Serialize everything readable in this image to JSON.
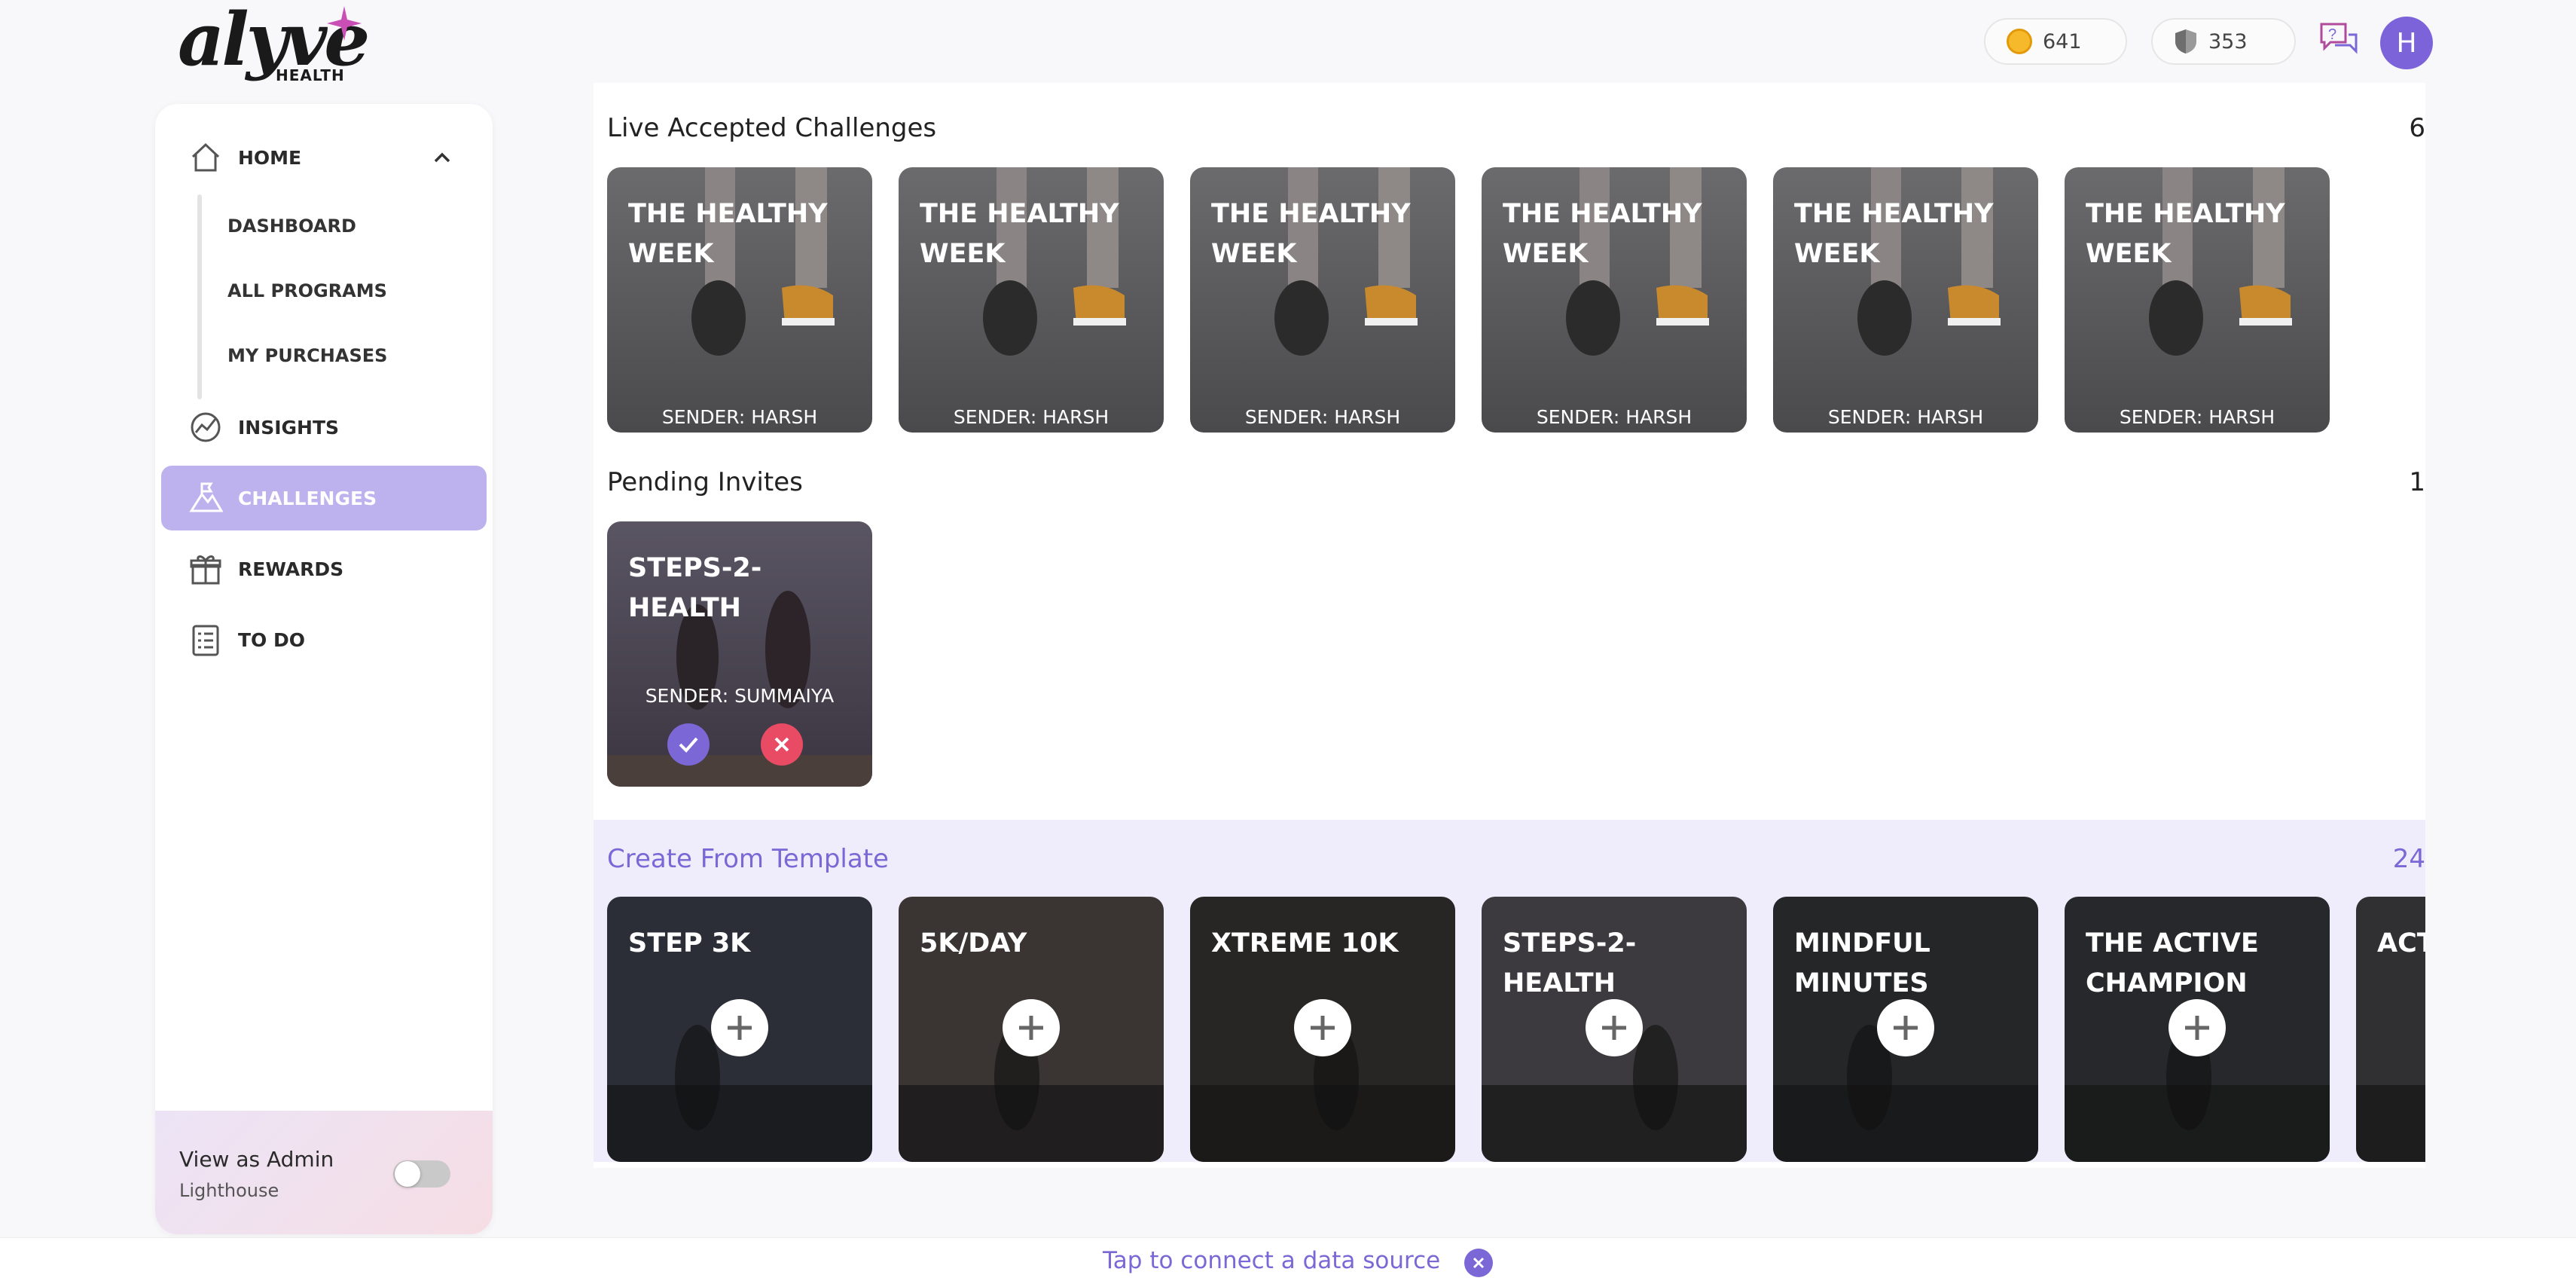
{
  "brand": {
    "name": "alyve",
    "sub": "HEALTH"
  },
  "header": {
    "coins": "641",
    "shields": "353",
    "avatar_initial": "H"
  },
  "sidebar": {
    "home": "HOME",
    "sub_items": [
      "DASHBOARD",
      "ALL PROGRAMS",
      "MY PURCHASES"
    ],
    "insights": "INSIGHTS",
    "challenges": "CHALLENGES",
    "rewards": "REWARDS",
    "todo": "TO DO",
    "admin_title": "View as Admin",
    "admin_sub": "Lighthouse"
  },
  "live": {
    "title": "Live Accepted Challenges",
    "count": "6",
    "cards": [
      {
        "title": "THE HEALTHY WEEK",
        "sender": "SENDER: HARSH"
      },
      {
        "title": "THE HEALTHY WEEK",
        "sender": "SENDER: HARSH"
      },
      {
        "title": "THE HEALTHY WEEK",
        "sender": "SENDER: HARSH"
      },
      {
        "title": "THE HEALTHY WEEK",
        "sender": "SENDER: HARSH"
      },
      {
        "title": "THE HEALTHY WEEK",
        "sender": "SENDER: HARSH"
      },
      {
        "title": "THE HEALTHY WEEK",
        "sender": "SENDER: HARSH"
      }
    ]
  },
  "pending": {
    "title": "Pending Invites",
    "count": "1",
    "cards": [
      {
        "title": "STEPS-2-HEALTH",
        "sender": "SENDER: SUMMAIYA"
      }
    ]
  },
  "templates": {
    "title": "Create From Template",
    "count": "24",
    "cards": [
      {
        "title": "STEP 3K"
      },
      {
        "title": "5K/DAY"
      },
      {
        "title": "XTREME 10K"
      },
      {
        "title": "STEPS-2-HEALTH"
      },
      {
        "title": "MINDFUL MINUTES"
      },
      {
        "title": "THE ACTIVE CHAMPION"
      },
      {
        "title": "ACT"
      }
    ]
  },
  "bottom": {
    "connect": "Tap to connect a data source"
  },
  "colors": {
    "accent": "#7b67d6",
    "active_nav": "#bdb2ee",
    "reject": "#e84b63",
    "coin": "#f5b92b"
  }
}
